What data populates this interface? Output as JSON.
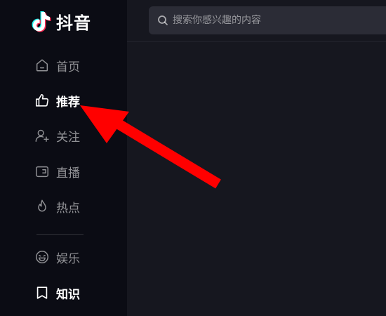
{
  "app": {
    "brand_name": "抖音",
    "brand_icon": "douyin-note-logo"
  },
  "search": {
    "placeholder": "搜索你感兴趣的内容",
    "icon": "search-icon"
  },
  "sidebar": {
    "items": [
      {
        "label": "首页",
        "icon": "home-icon",
        "active": false
      },
      {
        "label": "推荐",
        "icon": "thumbs-up-icon",
        "active": true
      },
      {
        "label": "关注",
        "icon": "user-plus-icon",
        "active": false
      },
      {
        "label": "直播",
        "icon": "live-tv-icon",
        "active": false
      },
      {
        "label": "热点",
        "icon": "flame-icon",
        "active": false
      }
    ],
    "items_below_divider": [
      {
        "label": "娱乐",
        "icon": "smile-icon"
      },
      {
        "label": "知识",
        "icon": "book-icon"
      }
    ]
  },
  "annotation": {
    "type": "arrow",
    "color": "#ff0000",
    "points_to": "推荐"
  },
  "colors": {
    "sidebar_bg": "#0b0c14",
    "main_bg": "#16171f",
    "search_bg": "#2b2c36",
    "accent_red": "#fe2c55",
    "accent_cyan": "#25f4ee"
  }
}
